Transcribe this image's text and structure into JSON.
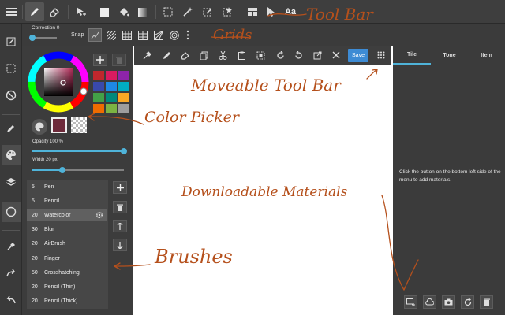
{
  "toolbar": {
    "buttons": [
      "menu-icon",
      "pen-icon",
      "eraser-icon",
      "move-select-icon",
      "fill-rect-icon",
      "bucket-icon",
      "gradient-icon",
      "select-rect-icon",
      "magic-wand-icon",
      "select-pen-icon",
      "select-eraser-icon",
      "layout-icon",
      "cursor-icon"
    ],
    "text_tool_label": "Aa"
  },
  "row2": {
    "correction_label": "Correction",
    "correction_value": "0",
    "snap_label": "Snap",
    "snap_buttons": [
      "snap-off",
      "parallel",
      "grid",
      "cross",
      "perspective",
      "radial"
    ]
  },
  "color_picker": {
    "swatches": [
      "#c0272d",
      "#d81b60",
      "#8e24aa",
      "#3949ab",
      "#1e88e5",
      "#00acc1",
      "#43a047",
      "#00897b",
      "#f9a825",
      "#ef6c00",
      "#7cb342",
      "#9e9e9e"
    ],
    "current_color": "#6d2a3a",
    "opacity_label": "Opacity 100 %",
    "opacity": 1.0,
    "width_label": "Width 20 px",
    "width": 0.33
  },
  "brushes": [
    {
      "size": "5",
      "name": "Pen"
    },
    {
      "size": "5",
      "name": "Pencil"
    },
    {
      "size": "20",
      "name": "Watercolor"
    },
    {
      "size": "30",
      "name": "Blur"
    },
    {
      "size": "20",
      "name": "AirBrush"
    },
    {
      "size": "20",
      "name": "Finger"
    },
    {
      "size": "50",
      "name": "Crosshatching"
    },
    {
      "size": "20",
      "name": "Pencil (Thin)"
    },
    {
      "size": "20",
      "name": "Pencil (Thick)"
    }
  ],
  "floating_toolbar": {
    "buttons": [
      "eyedropper-icon",
      "pen-icon",
      "eraser-icon",
      "copy-icon",
      "cut-icon",
      "paste-icon",
      "deselect-icon",
      "rotate-left-icon",
      "rotate-right-icon",
      "transform-icon",
      "close-icon"
    ],
    "save_label": "Save"
  },
  "right_panel": {
    "tabs": [
      "Tile",
      "Tone",
      "Item"
    ],
    "active_tab": "Tile",
    "message": "Click the button on the bottom left side of the menu to add materials."
  },
  "annotations": {
    "tool_bar": "Tool Bar",
    "grids": "Grids",
    "moveable": "Moveable Tool Bar",
    "color_picker": "Color Picker",
    "materials": "Downloadable Materials",
    "brushes": "Brushes"
  },
  "colors": {
    "accent": "#4fb3d9",
    "save_button": "#3d8bd4",
    "annotation": "#b5501c"
  }
}
